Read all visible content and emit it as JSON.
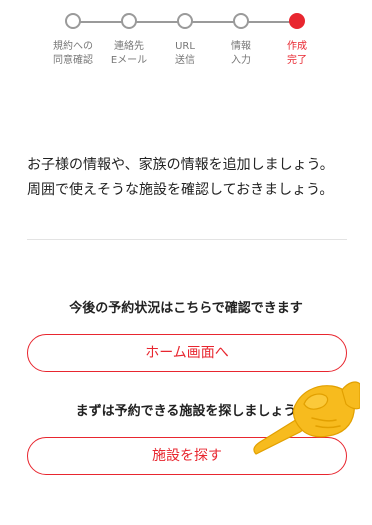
{
  "stepper": {
    "steps": [
      {
        "line1": "規約への",
        "line2": "同意確認",
        "active": false
      },
      {
        "line1": "連絡先",
        "line2": "Eメール",
        "active": false
      },
      {
        "line1": "URL",
        "line2": "送信",
        "active": false
      },
      {
        "line1": "情報",
        "line2": "入力",
        "active": false
      },
      {
        "line1": "作成",
        "line2": "完了",
        "active": true
      }
    ],
    "active_color": "#e8262f",
    "inactive_color": "#9a9a9a"
  },
  "intro": {
    "text": "お子様の情報や、家族の情報を追加しましょう。周囲で使えそうな施設を確認しておきましょう。"
  },
  "home_section": {
    "caption": "今後の予約状況はこちらで確認できます",
    "button_label": "ホーム画面へ"
  },
  "search_section": {
    "caption": "まずは予約できる施設を探しましょう",
    "button_label": "施設を探す"
  },
  "pointer": {
    "icon": "pointing-hand-icon",
    "color": "#f7bb1e"
  }
}
